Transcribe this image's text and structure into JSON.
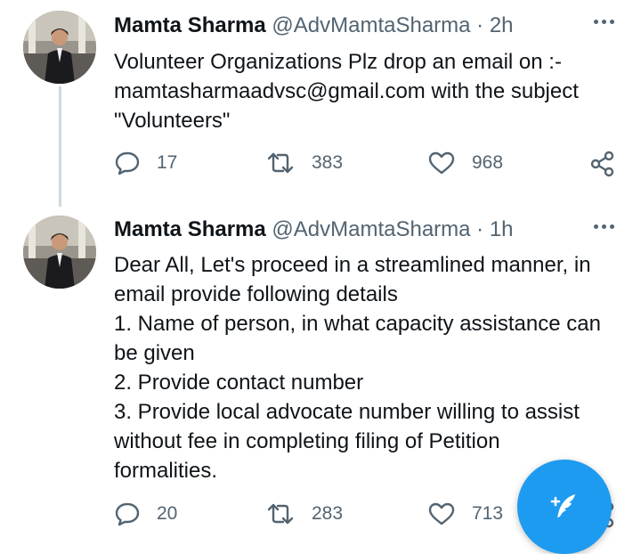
{
  "tweets": [
    {
      "author_name": "Mamta Sharma",
      "handle_time": "@AdvMamtaSharma · 2h",
      "text": "Volunteer Organizations Plz drop an email on :-\nmamtasharmaadvsc@gmail.com with the subject\n\"Volunteers\"",
      "replies": "17",
      "retweets": "383",
      "likes": "968"
    },
    {
      "author_name": "Mamta Sharma",
      "handle_time": "@AdvMamtaSharma · 1h",
      "text": "Dear All, Let's proceed in a streamlined manner, in\nemail provide following details\n1. Name of person, in what capacity assistance can\nbe given\n2. Provide contact number\n3. Provide local advocate number willing to assist\nwithout fee in completing filing of Petition\nformalities.",
      "replies": "20",
      "retweets": "283",
      "likes": "713"
    }
  ],
  "icons": {
    "more": "more-horizontal-icon",
    "reply": "reply-bubble-icon",
    "retweet": "retweet-icon",
    "like": "heart-icon",
    "share": "share-icon",
    "compose": "compose-feather-icon"
  },
  "colors": {
    "accent": "#1d9bf0",
    "secondary_text": "#536471",
    "thread_line": "#cfd9de"
  }
}
